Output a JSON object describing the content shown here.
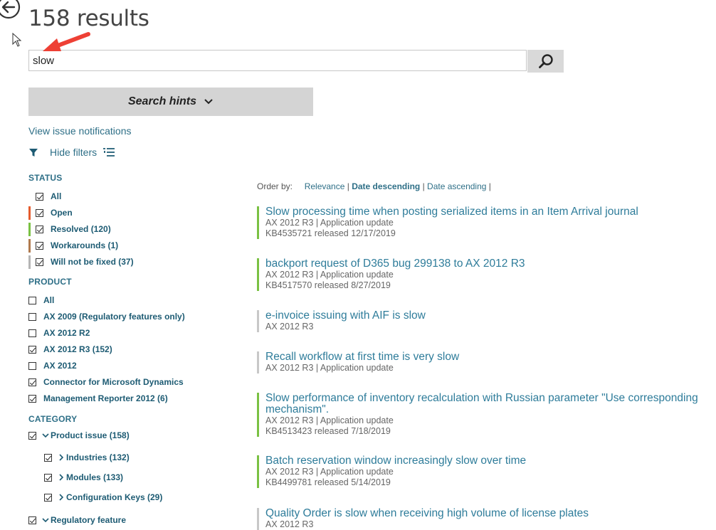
{
  "header": {
    "title": "158 results"
  },
  "search": {
    "value": "slow",
    "button_icon": "search-icon"
  },
  "hints": {
    "label": "Search hints"
  },
  "links": {
    "view_notifications": "View issue notifications",
    "hide_filters": "Hide filters"
  },
  "status": {
    "heading": "STATUS",
    "items": [
      {
        "label": "All",
        "checked": true,
        "color": ""
      },
      {
        "label": "Open",
        "checked": true,
        "color": "#e55b2d"
      },
      {
        "label": "Resolved (120)",
        "checked": true,
        "color": "#7ac143"
      },
      {
        "label": "Workarounds (1)",
        "checked": true,
        "color": "#b07a4e"
      },
      {
        "label": "Will not be fixed (37)",
        "checked": true,
        "color": "#b5b5b5"
      }
    ]
  },
  "product": {
    "heading": "PRODUCT",
    "items": [
      {
        "label": "All",
        "checked": false
      },
      {
        "label": "AX 2009 (Regulatory features only)",
        "checked": false
      },
      {
        "label": "AX 2012 R2",
        "checked": false
      },
      {
        "label": "AX 2012 R3 (152)",
        "checked": true
      },
      {
        "label": "AX 2012",
        "checked": false
      },
      {
        "label": "Connector for Microsoft Dynamics",
        "checked": true
      },
      {
        "label": "Management Reporter 2012 (6)",
        "checked": true
      }
    ]
  },
  "category": {
    "heading": "CATEGORY",
    "items": [
      {
        "label": "Product issue (158)",
        "checked": true
      },
      {
        "label": "Industries (132)",
        "checked": true
      },
      {
        "label": "Modules (133)",
        "checked": true
      },
      {
        "label": "Configuration Keys (29)",
        "checked": true
      },
      {
        "label": "Regulatory feature",
        "checked": true
      }
    ]
  },
  "order": {
    "label": "Order by:",
    "options": [
      "Relevance",
      "Date descending",
      "Date ascending"
    ],
    "separator": "|"
  },
  "results": [
    {
      "title": "Slow processing time when posting serialized items in an Item Arrival journal",
      "meta1": "AX 2012 R3 | Application update",
      "meta2": "KB4535721 released 12/17/2019",
      "status_color": "#7ac143"
    },
    {
      "title": "backport request of D365 bug 299138 to AX 2012 R3",
      "meta1": "AX 2012 R3 | Application update",
      "meta2": "KB4517570 released 8/27/2019",
      "status_color": "#7ac143"
    },
    {
      "title": "e-invoice issuing with AIF is slow",
      "meta1": "AX 2012 R3",
      "meta2": "",
      "status_color": "#c8c8c8"
    },
    {
      "title": "Recall workflow at first time is very slow",
      "meta1": "AX 2012 R3 | Application update",
      "meta2": "",
      "status_color": "#c8c8c8"
    },
    {
      "title": "Slow performance of inventory recalculation with Russian parameter \"Use corresponding",
      "title2": "mechanism\".",
      "meta1": "AX 2012 R3 | Application update",
      "meta2": "KB4513423 released 7/18/2019",
      "status_color": "#7ac143"
    },
    {
      "title": "Batch reservation window increasingly slow over time",
      "meta1": "AX 2012 R3 | Application update",
      "meta2": "KB4499781 released 5/14/2019",
      "status_color": "#7ac143"
    },
    {
      "title": "Quality Order is slow when receiving high volume of license plates",
      "meta1": "AX 2012 R3",
      "meta2": "",
      "status_color": "#c8c8c8"
    }
  ]
}
